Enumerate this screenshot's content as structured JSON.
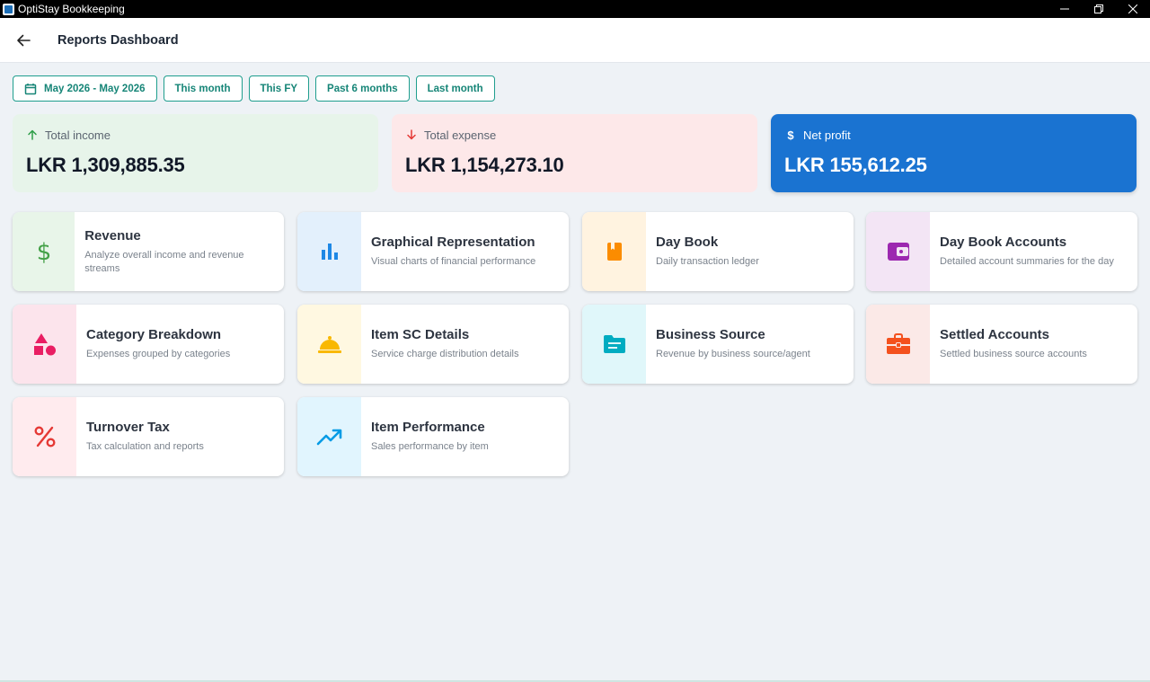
{
  "window": {
    "title": "OptiStay Bookkeeping"
  },
  "appbar": {
    "title": "Reports Dashboard"
  },
  "filters": [
    {
      "label": "May 2026 - May 2026",
      "icon": "calendar-icon"
    },
    {
      "label": "This month"
    },
    {
      "label": "This FY"
    },
    {
      "label": "Past 6 months"
    },
    {
      "label": "Last month"
    }
  ],
  "summary": {
    "income": {
      "label": "Total income",
      "value": "LKR 1,309,885.35",
      "icon": "arrow-up-icon",
      "color": "#2e9e48"
    },
    "expense": {
      "label": "Total expense",
      "value": "LKR 1,154,273.10",
      "icon": "arrow-down-icon",
      "color": "#e53935"
    },
    "net": {
      "label": "Net profit",
      "value": "LKR 155,612.25",
      "icon": "dollar-icon",
      "color": "#1a73d1"
    }
  },
  "reports": [
    {
      "title": "Revenue",
      "subtitle": "Analyze overall income and revenue streams",
      "icon": "dollar-icon",
      "accent": "#43a047",
      "bg": "#e8f5e9"
    },
    {
      "title": "Graphical Representation",
      "subtitle": "Visual charts of financial performance",
      "icon": "bar-chart-icon",
      "accent": "#1e88e5",
      "bg": "#e3f0fc"
    },
    {
      "title": "Day Book",
      "subtitle": "Daily transaction ledger",
      "icon": "book-icon",
      "accent": "#fb8c00",
      "bg": "#fff3e0"
    },
    {
      "title": "Day Book Accounts",
      "subtitle": "Detailed account summaries for the day",
      "icon": "wallet-icon",
      "accent": "#9c27b0",
      "bg": "#f3e5f5"
    },
    {
      "title": "Category Breakdown",
      "subtitle": "Expenses grouped by categories",
      "icon": "category-icon",
      "accent": "#e91e63",
      "bg": "#fce4ec"
    },
    {
      "title": "Item SC Details",
      "subtitle": "Service charge distribution details",
      "icon": "room-service-icon",
      "accent": "#f9b800",
      "bg": "#fff8e1"
    },
    {
      "title": "Business Source",
      "subtitle": "Revenue by business source/agent",
      "icon": "source-icon",
      "accent": "#00acc1",
      "bg": "#e0f7fa"
    },
    {
      "title": "Settled Accounts",
      "subtitle": "Settled business source accounts",
      "icon": "briefcase-icon",
      "accent": "#f4511e",
      "bg": "#fbe9e7"
    },
    {
      "title": "Turnover Tax",
      "subtitle": "Tax calculation and reports",
      "icon": "percent-icon",
      "accent": "#e53935",
      "bg": "#ffebee"
    },
    {
      "title": "Item Performance",
      "subtitle": "Sales performance by item",
      "icon": "trending-up-icon",
      "accent": "#039be5",
      "bg": "#e1f5fe"
    }
  ]
}
